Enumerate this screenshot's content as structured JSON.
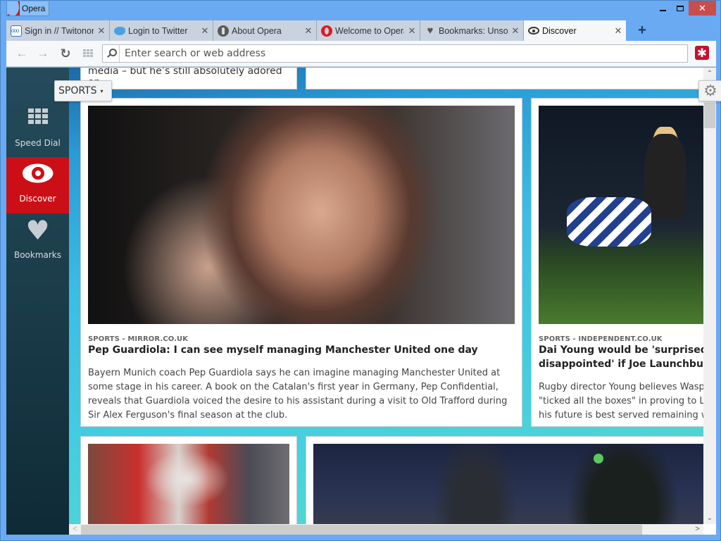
{
  "window": {
    "app_name": "Opera",
    "controls": {
      "minimize": "minimize",
      "maximize": "maximize",
      "close": "✕"
    }
  },
  "tabs": [
    {
      "title": "Sign in // Twitonomy",
      "icon": "twitonomy-icon",
      "close": "✕",
      "active": false
    },
    {
      "title": "Login to Twitter",
      "icon": "twitter-bird-icon",
      "close": "✕",
      "active": false
    },
    {
      "title": "About Opera",
      "icon": "opera-grey-icon",
      "close": "✕",
      "active": false
    },
    {
      "title": "Welcome to Opera",
      "icon": "opera-red-icon",
      "close": "✕",
      "active": false
    },
    {
      "title": "Bookmarks: Unsorted",
      "icon": "heart-icon",
      "close": "✕",
      "active": false
    },
    {
      "title": "Discover",
      "icon": "eye-icon",
      "close": "✕",
      "active": true
    }
  ],
  "new_tab_label": "+",
  "toolbar": {
    "back": "←",
    "forward": "→",
    "reload": "↻",
    "address_placeholder": "Enter search or web address",
    "address_value": "",
    "extension_glyph": "✱"
  },
  "sidebar": {
    "items": [
      {
        "label": "Speed Dial",
        "icon": "speed-dial-grid-icon",
        "active": false
      },
      {
        "label": "Discover",
        "icon": "eye-icon",
        "active": true
      },
      {
        "label": "Bookmarks",
        "icon": "heart-icon",
        "active": false
      }
    ]
  },
  "discover": {
    "category": "SPORTS",
    "category_caret": "▾",
    "settings_glyph": "⚙",
    "previous_snippet": "media – but he’s still absolutely adored on…",
    "articles": [
      {
        "meta": "SPORTS - MIRROR.CO.UK",
        "headline": "Pep Guardiola: I can see myself managing Manchester United one day",
        "summary": "Bayern Munich coach Pep Guardiola says he can imagine managing Manchester United at some stage in his career. A book on the Catalan's first year in Germany, Pep Confidential, reveals that Guardiola voiced the desire to his assistant during a visit to Old Trafford during Sir Alex Ferguson's final season at the club."
      },
      {
        "meta": "SPORTS - INDEPENDENT.CO.UK",
        "headline": "Dai Young would be 'surprised and disappointed' if Joe Launchbury quits",
        "summary_lines": [
          "Rugby director Young believes Wasps have",
          "\"ticked all the boxes\" in proving to Launchbury",
          "his future is best served remaining with the club"
        ]
      }
    ]
  },
  "scrollbars": {
    "up": "⌃",
    "down": "⌄",
    "left": "<",
    "right": ">"
  }
}
